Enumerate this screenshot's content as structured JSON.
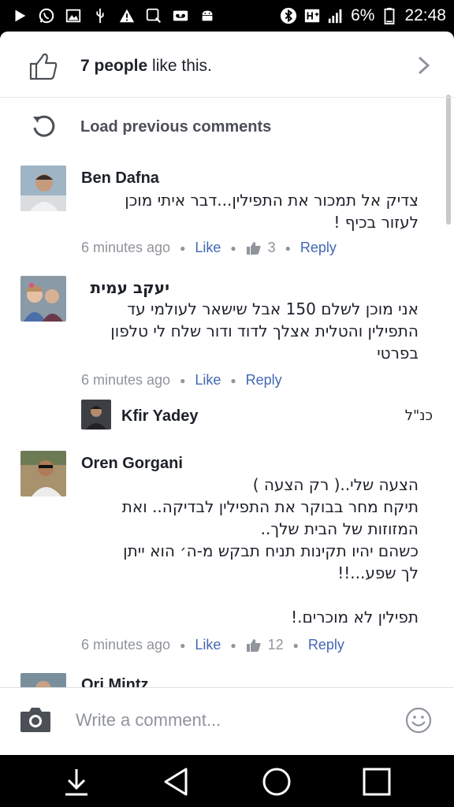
{
  "status": {
    "battery": "6%",
    "time": "22:48"
  },
  "likes": {
    "count": "7 people",
    "suffix": " like this."
  },
  "load_previous": "Load previous comments",
  "comments": [
    {
      "author": "Ben Dafna",
      "text": "צדיק אל תמכור את התפילין...דבר איתי מוכן\nלעזור בכיף !",
      "time": "6 minutes ago",
      "like": "Like",
      "likes": "3",
      "reply": "Reply"
    },
    {
      "author": "יעקב עמית",
      "text": "אני מוכן לשלם 150 אבל  שישאר לעולמי עד\nהתפילין והטלית אצלך לדוד ודור שלח לי טלפון\nבפרטי",
      "time": "6 minutes ago",
      "like": "Like",
      "reply": "Reply"
    },
    {
      "author": "Oren Gorgani",
      "text": "הצעה שלי..( רק הצעה )\nתיקח מחר בבוקר את התפילין לבדיקה.. ואת\nהמזוזות של הבית שלך..\nכשהם יהיו תקינות  תניח תבקש מ-ה׳ הוא ייתן\nלך שפע...!!\n\nתפילין לא מוכרים.!",
      "time": "6 minutes ago",
      "like": "Like",
      "likes": "12",
      "reply": "Reply"
    },
    {
      "author": "Ori Mintz"
    }
  ],
  "reply_preview": {
    "author": "Kfir Yadey",
    "text": "כנ\"ל"
  },
  "composer": {
    "placeholder": "Write a comment..."
  }
}
